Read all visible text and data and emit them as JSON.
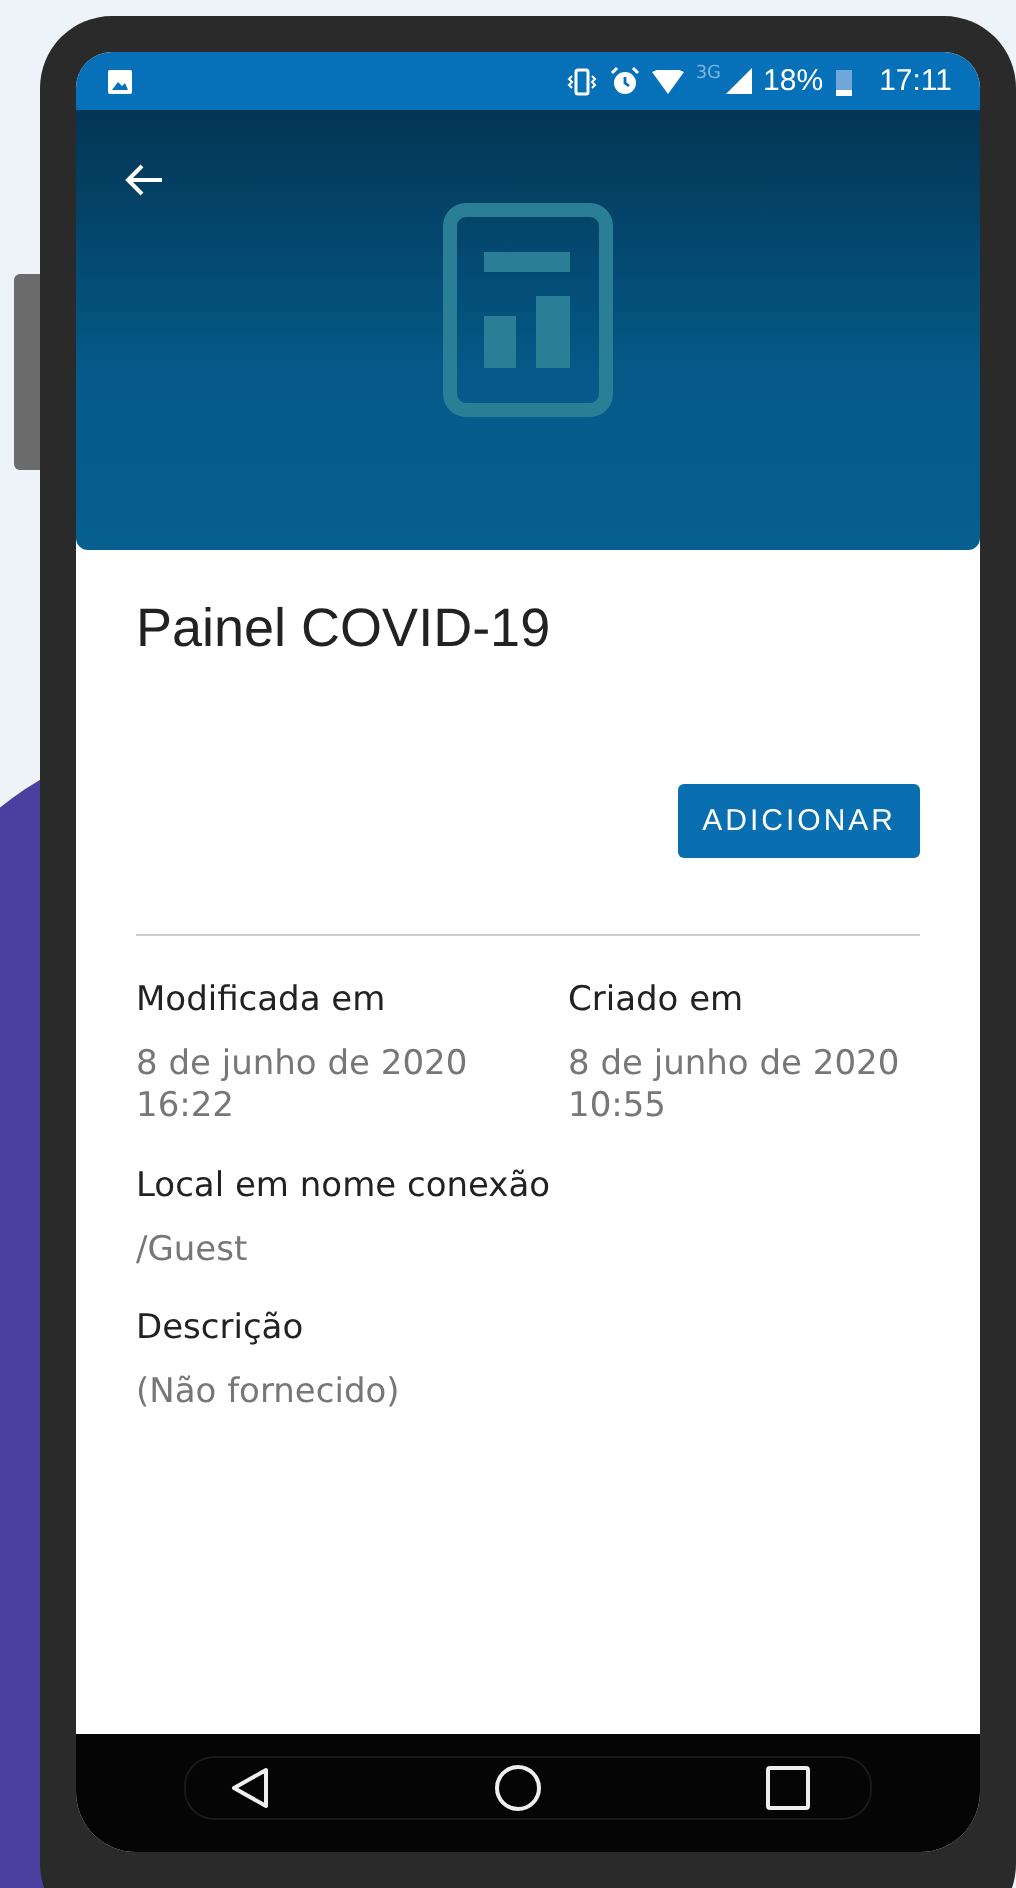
{
  "status_bar": {
    "network": "3G",
    "battery": "18%",
    "time": "17:11"
  },
  "item": {
    "title": "Painel COVID-19",
    "action": "ADICIONAR"
  },
  "dates": [
    {
      "label": "Modificada em",
      "value": "8 de junho de 2020 16:22"
    },
    {
      "label": "Criado em",
      "value": "8 de junho de 2020 10:55"
    }
  ],
  "fields": [
    {
      "label": "Local em nome conexão",
      "value": "/Guest"
    },
    {
      "label": "Descrição",
      "value": "(Não fornecido)"
    }
  ]
}
